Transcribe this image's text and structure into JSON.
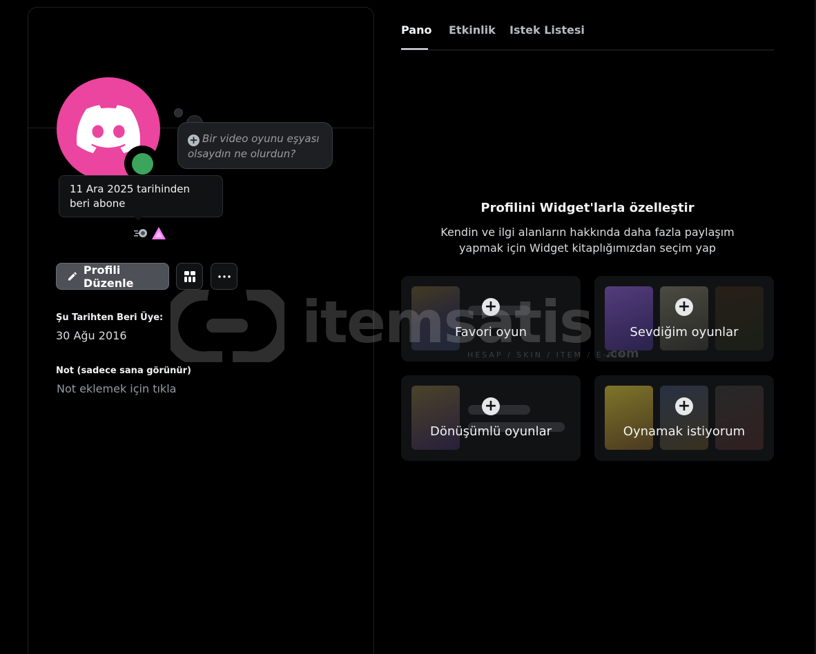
{
  "profile": {
    "display_name": "",
    "thought_bubble": "Bir video oyunu eşyası olsaydın ne olurdun?",
    "tooltip": "11 Ara 2025 tarihinden beri abone",
    "edit_button": "Profili Düzenle",
    "member_since_label": "Şu Tarihten Beri Üye:",
    "member_since_value": "30 Ağu 2016",
    "note_label": "Not (sadece sana görünür)",
    "note_placeholder": "Not eklemek için tıkla",
    "colors": {
      "avatar_bg": "#eb459f",
      "status_online": "#3ba55c"
    },
    "icons": [
      "discord-logo",
      "pencil-icon",
      "widgets-icon",
      "more-icon",
      "nitro-badge-icon",
      "boost-badge-icon"
    ]
  },
  "tabs": [
    {
      "label": "Pano",
      "active": true
    },
    {
      "label": "Etkinlik",
      "active": false
    },
    {
      "label": "Istek Listesi",
      "active": false
    }
  ],
  "widgets": {
    "title": "Profilini Widget'larla özelleştir",
    "subtitle_line1": "Kendin ve ilgi alanların hakkında daha fazla paylaşım",
    "subtitle_line2": "yapmak için Widget kitaplığımızdan seçim yap",
    "cards": [
      {
        "label": "Favori oyun"
      },
      {
        "label": "Sevdiğim oyunlar"
      },
      {
        "label": "Dönüşümlü oyunlar"
      },
      {
        "label": "Oynamak istiyorum"
      }
    ]
  },
  "watermark": {
    "name": "itemsatis",
    "tagline": "HESAP / SKIN / ITEM / E-PIN",
    "suffix": ".com"
  }
}
